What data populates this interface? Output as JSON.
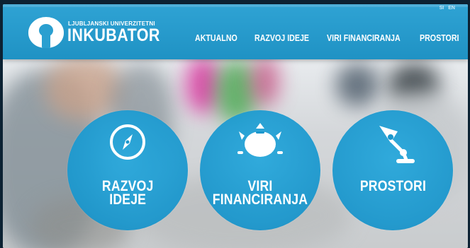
{
  "brand": {
    "top_line": "LJUBLJANSKI UNIVERZITETNI",
    "name": "INKUBATOR"
  },
  "language": [
    "SI",
    "EN"
  ],
  "nav": [
    {
      "label": "AKTUALNO"
    },
    {
      "label": "RAZVOJ IDEJE"
    },
    {
      "label": "VIRI FINANCIRANJA"
    },
    {
      "label": "PROSTORI"
    }
  ],
  "features": [
    {
      "lines": [
        "RAZVOJ",
        "IDEJE"
      ],
      "icon": "compass-icon"
    },
    {
      "lines": [
        "VIRI",
        "FINANCIRANJA"
      ],
      "icon": "piggy-bank-icon"
    },
    {
      "lines": [
        "PROSTORI"
      ],
      "icon": "desk-lamp-icon"
    }
  ],
  "colors": {
    "header": "#1f92c4",
    "circle": "#1b97cd",
    "text": "#ffffff"
  }
}
